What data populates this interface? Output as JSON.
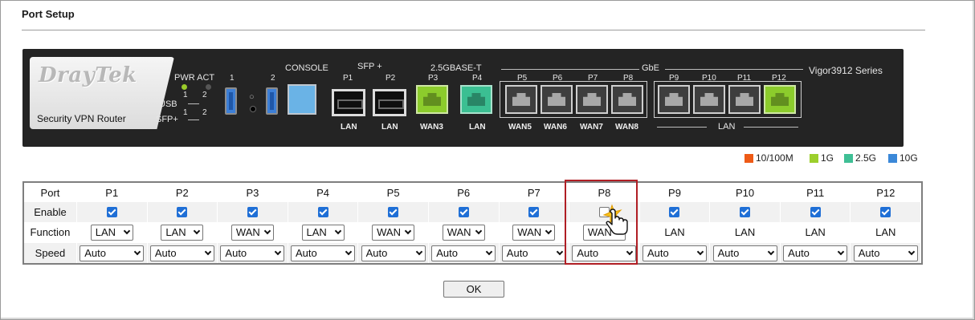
{
  "page": {
    "title": "Port Setup"
  },
  "router": {
    "brand": "DrayTek",
    "model_label": "Security VPN Router",
    "series": "Vigor3912 Series",
    "labels": {
      "pwr_act": "PWR ACT",
      "usb": "USB",
      "sfp_plus": "SFP+",
      "one": "1",
      "two": "2",
      "console": "CONSOLE",
      "sfp_header": "SFP +",
      "base_t_header": "2.5GBASE-T",
      "gbe_header": "GbE",
      "lan_group": "LAN"
    },
    "port_names": [
      "P1",
      "P2",
      "P3",
      "P4",
      "P5",
      "P6",
      "P7",
      "P8",
      "P9",
      "P10",
      "P11",
      "P12"
    ],
    "port_roles": [
      "LAN",
      "LAN",
      "WAN3",
      "LAN",
      "WAN5",
      "WAN6",
      "WAN7",
      "WAN8"
    ],
    "port_speed_colors": [
      "none",
      "none",
      "green",
      "teal",
      "grey",
      "grey",
      "grey",
      "grey",
      "grey",
      "grey",
      "grey",
      "green"
    ]
  },
  "legend": [
    {
      "label": "10/100M",
      "color": "#ee5a16"
    },
    {
      "label": "1G",
      "color": "#9ccf2c"
    },
    {
      "label": "2.5G",
      "color": "#3fbf95"
    },
    {
      "label": "10G",
      "color": "#3b88d8"
    }
  ],
  "table": {
    "row_labels": {
      "port": "Port",
      "enable": "Enable",
      "function": "Function",
      "speed": "Speed"
    },
    "ports": [
      {
        "name": "P1",
        "enabled": true,
        "function": "LAN",
        "function_type": "select",
        "speed": "Auto"
      },
      {
        "name": "P2",
        "enabled": true,
        "function": "LAN",
        "function_type": "select",
        "speed": "Auto"
      },
      {
        "name": "P3",
        "enabled": true,
        "function": "WAN",
        "function_type": "select",
        "speed": "Auto"
      },
      {
        "name": "P4",
        "enabled": true,
        "function": "LAN",
        "function_type": "select",
        "speed": "Auto"
      },
      {
        "name": "P5",
        "enabled": true,
        "function": "WAN",
        "function_type": "select",
        "speed": "Auto"
      },
      {
        "name": "P6",
        "enabled": true,
        "function": "WAN",
        "function_type": "select",
        "speed": "Auto"
      },
      {
        "name": "P7",
        "enabled": true,
        "function": "WAN",
        "function_type": "select",
        "speed": "Auto"
      },
      {
        "name": "P8",
        "enabled": false,
        "function": "WAN",
        "function_type": "select",
        "speed": "Auto"
      },
      {
        "name": "P9",
        "enabled": true,
        "function": "LAN",
        "function_type": "text",
        "speed": "Auto"
      },
      {
        "name": "P10",
        "enabled": true,
        "function": "LAN",
        "function_type": "text",
        "speed": "Auto"
      },
      {
        "name": "P11",
        "enabled": true,
        "function": "LAN",
        "function_type": "text",
        "speed": "Auto"
      },
      {
        "name": "P12",
        "enabled": true,
        "function": "LAN",
        "function_type": "text",
        "speed": "Auto"
      }
    ]
  },
  "actions": {
    "ok_label": "OK"
  }
}
